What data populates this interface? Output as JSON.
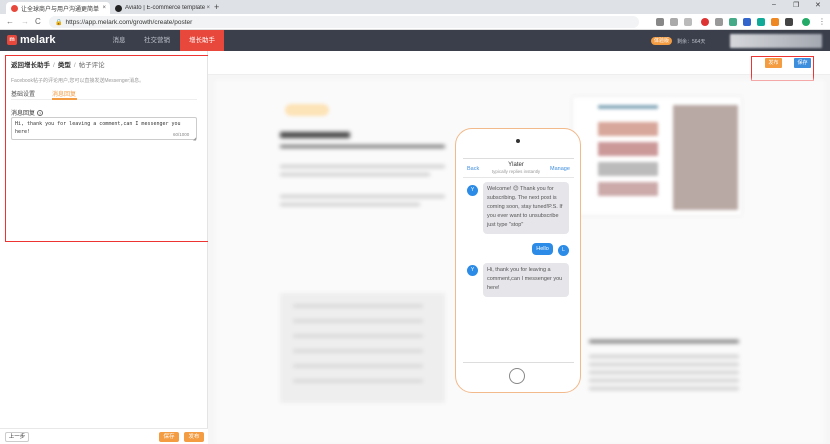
{
  "browser": {
    "tabs": [
      {
        "title": "让全球商户与用户沟通更简单",
        "active": true
      },
      {
        "title": "Aviato | E-commerce template",
        "active": false
      }
    ],
    "new_tab": "+",
    "close_tab": "×",
    "window_min": "–",
    "window_max": "❐",
    "window_close": "✕",
    "url": "https://app.melark.com/growth/create/poster",
    "back": "←",
    "forward": "→",
    "reload": "C"
  },
  "app": {
    "logo_text": "melark",
    "logo_mark": "m",
    "nav": [
      {
        "label": "消息",
        "active": false
      },
      {
        "label": "社交营销",
        "active": false
      },
      {
        "label": "增长助手",
        "active": true
      }
    ],
    "badge": "体验版",
    "remaining": "剩余：564天"
  },
  "left": {
    "breadcrumb": [
      "返回增长助手",
      "类型",
      "帖子评论"
    ],
    "description": "Facebook帖子的评论用户,您可以直接发送Messenger消息。",
    "tabs": [
      {
        "label": "基础设置",
        "active": false
      },
      {
        "label": "消息回复",
        "active": true
      }
    ],
    "field_label": "消息回复",
    "help_icon": "?",
    "message": "Hi, thank you for leaving a comment,can I messenger you here!",
    "counter": "60/1000",
    "footer": {
      "prev": "上一步",
      "save": "保存",
      "publish": "发布"
    }
  },
  "toolbar": {
    "publish": "发布",
    "save": "保存"
  },
  "preview": {
    "back": "Back",
    "page_name": "Ylater",
    "page_status": "typically replies instantly",
    "manage": "Manage",
    "messages": [
      {
        "from": "page",
        "avatar": "Y",
        "text": "Welcome! 😊 Thank you for subscribing. The next post is coming soon, stay tuned!P.S. If you ever want to unsubscribe just type \"stop\""
      },
      {
        "from": "user",
        "avatar": "L",
        "text": "Hello"
      },
      {
        "from": "page",
        "avatar": "Y",
        "text": "Hi, thank you for leaving a comment,can I messenger you here!"
      }
    ]
  },
  "colors": {
    "accent": "#f39c42",
    "brand_red": "#e8483b",
    "blue": "#3e8ede",
    "header_bg": "#3a3f4b"
  }
}
